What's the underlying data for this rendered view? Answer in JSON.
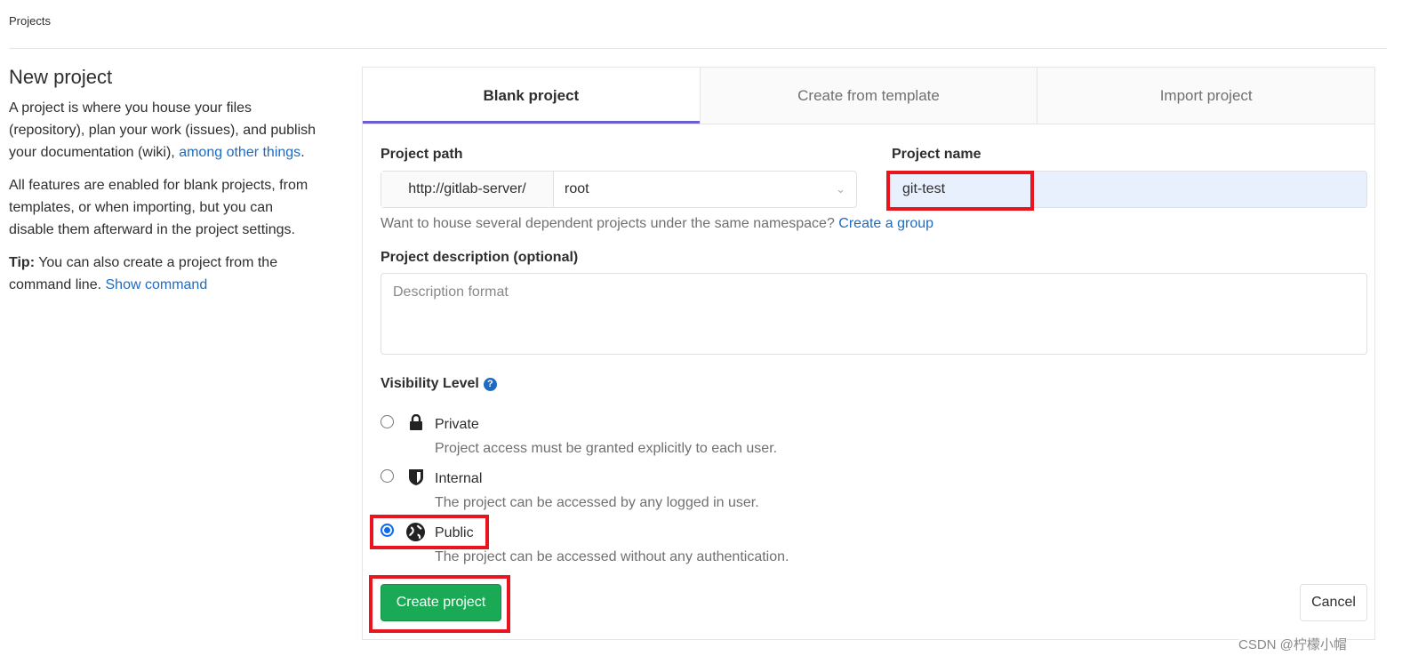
{
  "breadcrumb": "Projects",
  "sidebar": {
    "title": "New project",
    "p1": "A project is where you house your files (repository), plan your work (issues), and publish your documentation (wiki),",
    "p1_link": "among other things",
    "p1_end": ".",
    "p2": "All features are enabled for blank projects, from templates, or when importing, but you can disable them afterward in the project settings.",
    "tip_label": "Tip:",
    "tip": "You can also create a project from the command line.",
    "tip_link": "Show command"
  },
  "tabs": [
    {
      "label": "Blank project",
      "active": true
    },
    {
      "label": "Create from template"
    },
    {
      "label": "Import project"
    }
  ],
  "form": {
    "path_label": "Project path",
    "path_prefix": "http://gitlab-server/",
    "namespace": "root",
    "name_label": "Project name",
    "name_value": "git-test",
    "group_help": "Want to house several dependent projects under the same namespace?",
    "group_link": "Create a group",
    "desc_label": "Project description (optional)",
    "desc_placeholder": "Description format",
    "visibility_label": "Visibility Level",
    "visibility": [
      {
        "title": "Private",
        "desc": "Project access must be granted explicitly to each user.",
        "icon": "lock-icon",
        "checked": false
      },
      {
        "title": "Internal",
        "desc": "The project can be accessed by any logged in user.",
        "icon": "shield-icon",
        "checked": false
      },
      {
        "title": "Public",
        "desc": "The project can be accessed without any authentication.",
        "icon": "globe-icon",
        "checked": true
      }
    ],
    "create_label": "Create project",
    "cancel_label": "Cancel"
  },
  "watermark": "CSDN @柠檬小帽",
  "colors": {
    "accent": "#6b5fcf",
    "primary_button": "#1aaa55",
    "link": "#1f6bc1",
    "highlight": "#e8141e"
  }
}
